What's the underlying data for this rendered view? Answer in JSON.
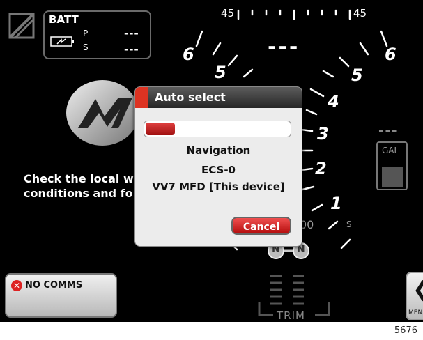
{
  "battery": {
    "title": "BATT",
    "p_label": "P",
    "s_label": "S",
    "p_value": "---",
    "s_value": "---"
  },
  "gauge": {
    "left_numbers": [
      "6",
      "5"
    ],
    "right_numbers": [
      "6",
      "5",
      "4",
      "3",
      "2",
      "1"
    ],
    "top_left": "45",
    "top_right": "45",
    "center_value": "---",
    "partial_text_1": "00",
    "partial_text_2": "S",
    "neutral_labels": [
      "N",
      "N"
    ],
    "trim_label": "TRIM"
  },
  "message": {
    "line1": "Check the local w",
    "line2": "conditions and fo"
  },
  "fuel": {
    "value": "---",
    "label": "GAL",
    "level": 0.5
  },
  "no_comms": {
    "label": "NO COMMS"
  },
  "menu": {
    "label": "MEN"
  },
  "dialog": {
    "title": "Auto select",
    "progress": 0.2,
    "line1": "Navigation",
    "line2": "ECS-0",
    "line3": "VV7 MFD [This device]",
    "cancel_label": "Cancel"
  },
  "image_code": "5676"
}
